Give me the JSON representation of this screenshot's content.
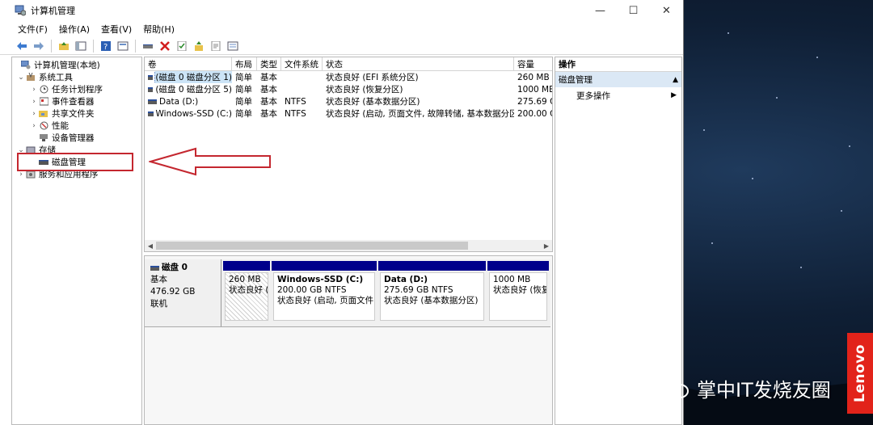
{
  "window": {
    "title": "计算机管理",
    "minimize": "—",
    "maximize": "☐",
    "close": "✕"
  },
  "menu": [
    "文件(F)",
    "操作(A)",
    "查看(V)",
    "帮助(H)"
  ],
  "tree": {
    "root": "计算机管理(本地)",
    "system_tools": "系统工具",
    "task_scheduler": "任务计划程序",
    "event_viewer": "事件查看器",
    "shared_folders": "共享文件夹",
    "performance": "性能",
    "device_manager": "设备管理器",
    "storage": "存储",
    "disk_management": "磁盘管理",
    "services_apps": "服务和应用程序"
  },
  "volumes": {
    "headers": [
      "卷",
      "布局",
      "类型",
      "文件系统",
      "状态",
      "容量"
    ],
    "rows": [
      [
        "(磁盘 0 磁盘分区 1)",
        "简单",
        "基本",
        "",
        "状态良好 (EFI 系统分区)",
        "260 MB"
      ],
      [
        "(磁盘 0 磁盘分区 5)",
        "简单",
        "基本",
        "",
        "状态良好 (恢复分区)",
        "1000 ME"
      ],
      [
        "Data (D:)",
        "简单",
        "基本",
        "NTFS",
        "状态良好 (基本数据分区)",
        "275.69 G"
      ],
      [
        "Windows-SSD (C:)",
        "简单",
        "基本",
        "NTFS",
        "状态良好 (启动, 页面文件, 故障转储, 基本数据分区)",
        "200.00 G"
      ]
    ]
  },
  "disk": {
    "name": "磁盘 0",
    "type": "基本",
    "size": "476.92 GB",
    "status": "联机",
    "partitions": [
      {
        "name": "",
        "size": "260 MB",
        "status": "状态良好 ("
      },
      {
        "name": "Windows-SSD  (C:)",
        "size": "200.00 GB NTFS",
        "status": "状态良好 (启动, 页面文件, 古"
      },
      {
        "name": "Data  (D:)",
        "size": "275.69 GB NTFS",
        "status": "状态良好 (基本数据分区)"
      },
      {
        "name": "",
        "size": "1000 MB",
        "status": "状态良好 (恢复"
      }
    ]
  },
  "actions": {
    "header": "操作",
    "section": "磁盘管理",
    "more": "更多操作"
  },
  "watermark": "掌中IT发烧友圈",
  "brand": "Lenovo",
  "colors": {
    "partition_bar": "#00008b",
    "annotation": "#c4272f",
    "selection": "#cce4f7"
  }
}
